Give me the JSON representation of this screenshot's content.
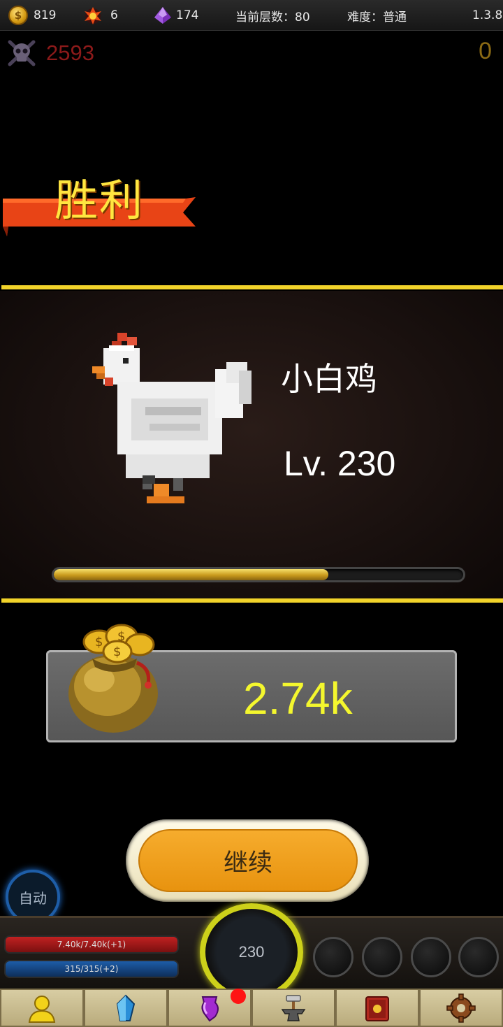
{
  "topbar": {
    "coins": "819",
    "fire": "6",
    "gems": "174",
    "floor": "当前层数：80",
    "difficulty": "难度：普通",
    "version": "1.3.8"
  },
  "kills": "2593",
  "zero_count": "0",
  "victory_label": "胜利",
  "monster": {
    "name": "小白鸡",
    "level": "Lv. 230",
    "progress_fraction": 0.67
  },
  "reward": {
    "value": "2.74k"
  },
  "continue_label": "继续",
  "auto_label": "自动",
  "hud": {
    "hp": "7.40k/7.40k(+1)",
    "mp": "315/315(+2)",
    "level": "230"
  },
  "nav": {
    "items": [
      "character-icon",
      "crystal-icon",
      "potion-icon",
      "anvil-icon",
      "book-icon",
      "gear-icon"
    ],
    "notification_on": "potion-icon"
  },
  "colors": {
    "victory_text": "#ffe640",
    "ribbon": "#e84416",
    "divider": "#f2d32a",
    "reward_text": "#f4f72e",
    "button": "#f0a020"
  }
}
